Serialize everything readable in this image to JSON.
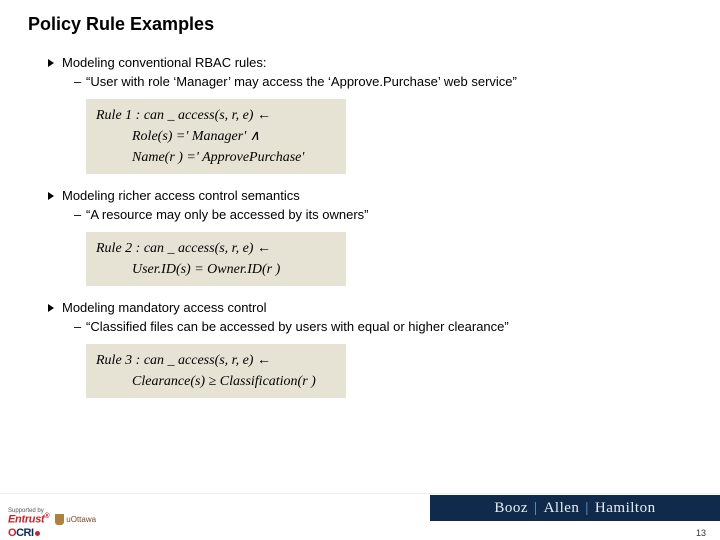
{
  "title": "Policy Rule Examples",
  "sections": [
    {
      "heading": "Modeling conventional RBAC rules:",
      "sub": "“User with role ‘Manager’ may access the ‘Approve.Purchase’ web service”",
      "formula": {
        "line1": "Rule 1 : can _ access(s, r, e) ←",
        "line2": "Role(s) =' Manager'    ∧",
        "line3": "Name(r ) =' ApprovePurchase'"
      }
    },
    {
      "heading": "Modeling richer access control semantics",
      "sub": "“A resource may only be accessed by its owners”",
      "formula": {
        "line1": "Rule 2 : can _ access(s, r, e) ←",
        "line2": "User.ID(s) = Owner.ID(r )",
        "line3": ""
      }
    },
    {
      "heading": "Modeling mandatory access control",
      "sub": "“Classified files can be accessed by users with equal or higher clearance”",
      "formula": {
        "line1": "Rule 3 : can _ access(s, r, e) ←",
        "line2": "Clearance(s) ≥ Classification(r )",
        "line3": ""
      }
    }
  ],
  "footer": {
    "support_label": "Supported by",
    "brand": {
      "p1": "Booz",
      "p2": "Allen",
      "p3": "Hamilton"
    },
    "logos": {
      "entrust": "Entrust",
      "uottawa": "uOttawa",
      "ocri_o": "O",
      "ocri_rest": "CRI"
    }
  },
  "page_number": "13"
}
